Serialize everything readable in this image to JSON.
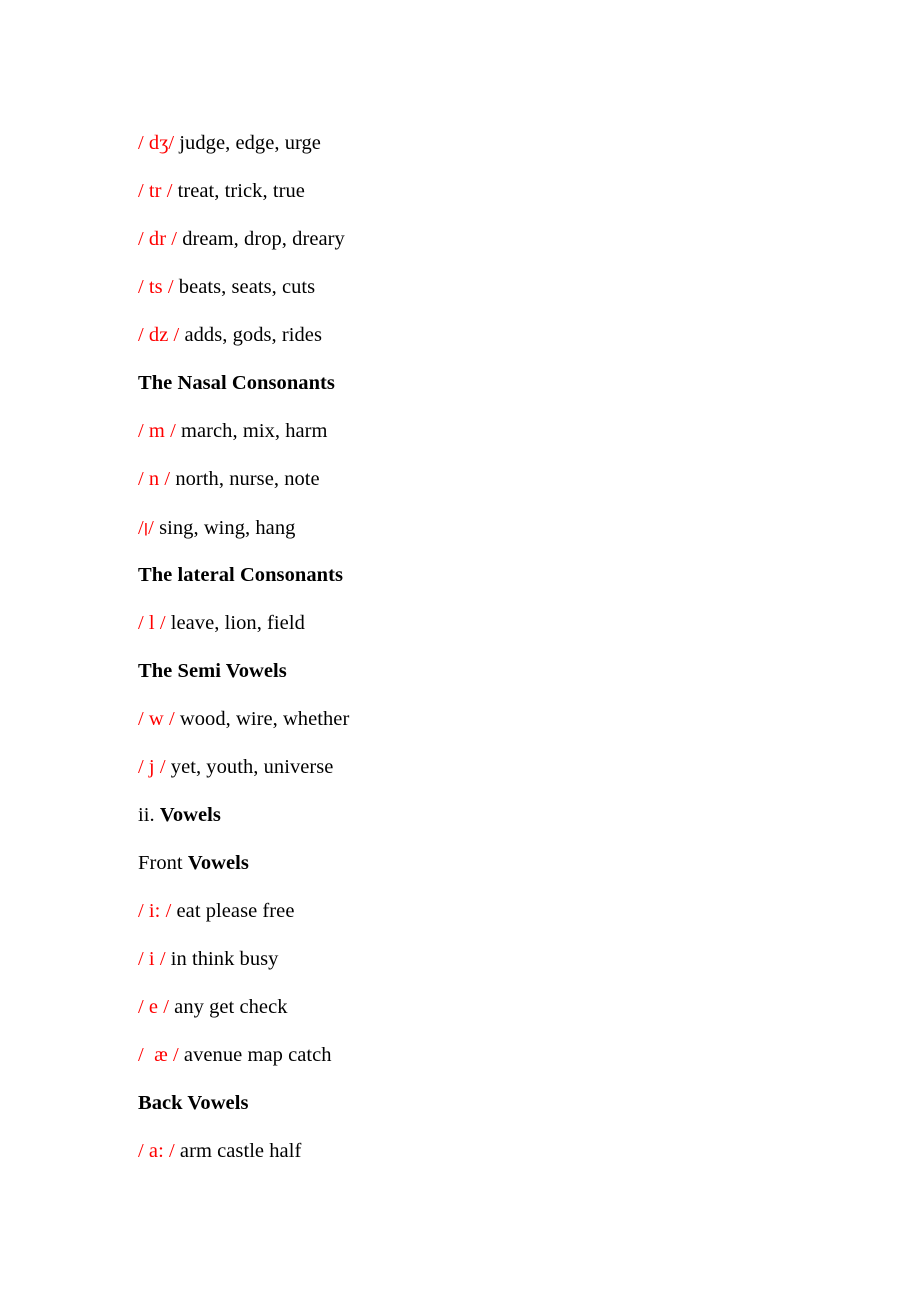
{
  "document": {
    "background_color": "#ffffff",
    "text_color": "#000000",
    "symbol_color": "#FF0000"
  },
  "lines": [
    {
      "symbol": "/ dʒ/ ",
      "words": "judge, edge, urge"
    },
    {
      "symbol": "/ tr / ",
      "words": "treat, trick, true"
    },
    {
      "symbol": "/ dr / ",
      "words": "dream, drop, dreary"
    },
    {
      "symbol": "/ ts / ",
      "words": "beats, seats, cuts"
    },
    {
      "symbol": "/ dz / ",
      "words": "adds, gods, rides"
    },
    {
      "heading": "The Nasal Consonants"
    },
    {
      "symbol": "/ m / ",
      "words": "march, mix, harm"
    },
    {
      "symbol": "/ n / ",
      "words": "north, nurse, note"
    },
    {
      "symbol_prefix": "/",
      "symbol_glyph": "ן",
      "symbol_suffix": "/ ",
      "words": "sing, wing, hang"
    },
    {
      "heading": "The lateral Consonants"
    },
    {
      "symbol": "/ l / ",
      "words": "leave, lion, field"
    },
    {
      "heading": "The Semi Vowels"
    },
    {
      "symbol": "/ w / ",
      "words": "wood, wire, whether"
    },
    {
      "symbol": "/ j / ",
      "words": "yet, youth, universe"
    },
    {
      "regular_prefix": "ii. ",
      "bold_text": "Vowels"
    },
    {
      "regular_prefix": "Front ",
      "bold_text": "Vowels"
    },
    {
      "symbol": "/ i: / ",
      "words": "eat please free"
    },
    {
      "symbol": "/ i / ",
      "words": "in think busy"
    },
    {
      "symbol": "/ e / ",
      "words": "any get check"
    },
    {
      "symbol": "/  æ / ",
      "words": "avenue map catch"
    },
    {
      "heading": "Back Vowels"
    },
    {
      "symbol": "/ a: / ",
      "words": "arm castle half"
    }
  ]
}
